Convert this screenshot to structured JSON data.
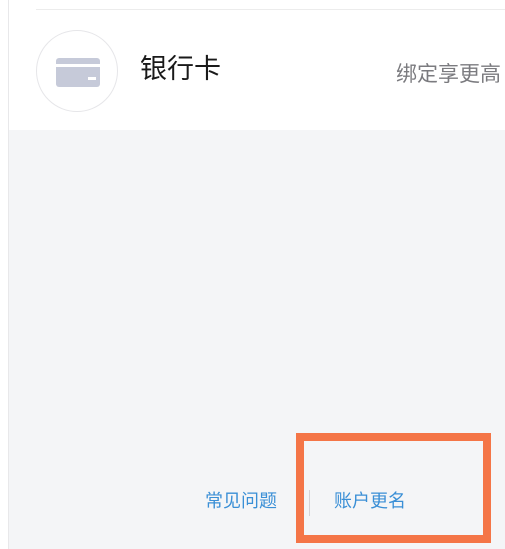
{
  "bank_card": {
    "title": "银行卡",
    "hint": "绑定享更高",
    "icon": "bank-card-icon"
  },
  "footer": {
    "faq_label": "常见问题",
    "rename_label": "账户更名"
  },
  "colors": {
    "link": "#3a8fd6",
    "highlight": "#f47547",
    "background": "#f4f5f7"
  }
}
